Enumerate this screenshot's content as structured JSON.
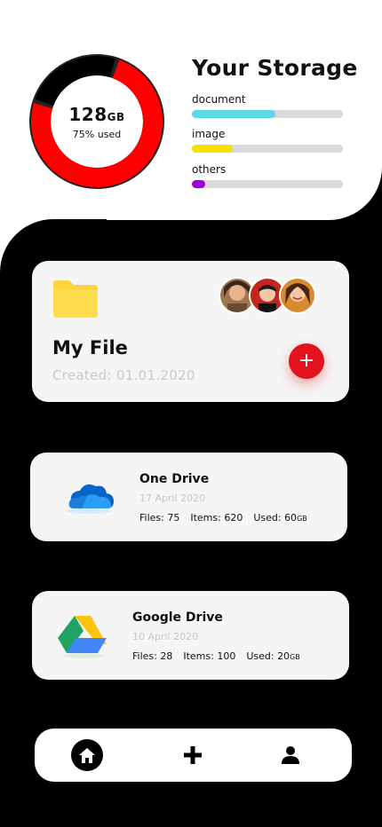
{
  "storage": {
    "title": "Your Storage",
    "total_value": "128",
    "total_unit": "GB",
    "used_text": "75% used",
    "used_fraction": 0.75,
    "colors": {
      "used": "#ff0000",
      "free": "#000000"
    },
    "bars": [
      {
        "label": "document",
        "fraction": 0.55,
        "color": "#5ad8e6"
      },
      {
        "label": "image",
        "fraction": 0.27,
        "color": "#f5e100"
      },
      {
        "label": "others",
        "fraction": 0.09,
        "color": "#9b00d9"
      }
    ]
  },
  "my_file": {
    "title": "My File",
    "created": "Created: 01.01.2020",
    "folder_icon": "folder-icon",
    "add_icon": "plus-icon",
    "add_label": "+",
    "accent": "#e3121f"
  },
  "drives": [
    {
      "name": "One Drive",
      "date": "17 April 2020",
      "files_label": "Files: 75",
      "items_label": "Items: 620",
      "used_label": "Used: 60",
      "used_unit": "GB",
      "icon": "onedrive-icon"
    },
    {
      "name": "Google Drive",
      "date": "10 April 2020",
      "files_label": "Files: 28",
      "items_label": "Items: 100",
      "used_label": "Used: 20",
      "used_unit": "GB",
      "icon": "google-drive-icon"
    }
  ],
  "nav": {
    "items": [
      {
        "icon": "home-icon",
        "active": true
      },
      {
        "icon": "plus-icon",
        "active": false
      },
      {
        "icon": "user-icon",
        "active": false
      }
    ]
  }
}
